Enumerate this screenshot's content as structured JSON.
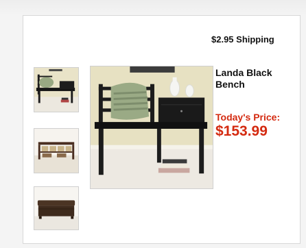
{
  "header": {
    "shipping_text": "$2.95 Shipping"
  },
  "product": {
    "name": "Landa Black Bench",
    "price_label": "Today's Price:",
    "price": "$153.99"
  },
  "gallery": {
    "thumbnails": [
      {
        "subject": "telephone bench with pillow"
      },
      {
        "subject": "storage bench with baskets"
      },
      {
        "subject": "brown leather storage ottoman"
      }
    ],
    "main_image": {
      "subject": "black telephone bench with green pillow and books"
    }
  },
  "colors": {
    "price": "#d42a10",
    "frame_border": "#d7d7d7"
  }
}
